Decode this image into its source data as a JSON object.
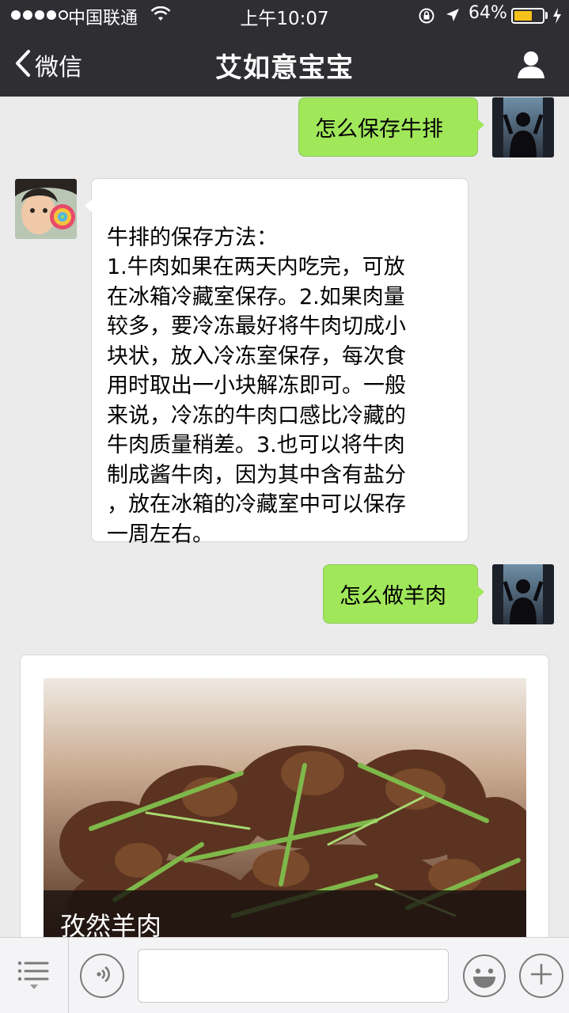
{
  "status_bar": {
    "carrier": "中国联通",
    "time": "上午10:07",
    "battery_percent": "64%",
    "battery_level": 0.64,
    "battery_color": "#f5c21b",
    "signal_bars_filled": 4,
    "signal_bars_total": 5
  },
  "nav": {
    "back_label": "微信",
    "title": "艾如意宝宝",
    "back_icon": "chevron-left-icon",
    "profile_icon": "person-icon"
  },
  "messages": [
    {
      "direction": "outgoing",
      "text": "怎么保存牛排",
      "avatar": "user-avatar"
    },
    {
      "direction": "incoming",
      "text": "牛排的保存方法：\n1.牛肉如果在两天内吃完，可放\n在冰箱冷藏室保存。2.如果肉量\n较多，要冷冻最好将牛肉切成小\n块状，放入冷冻室保存，每次食\n用时取出一小块解冻即可。一般\n来说，冷冻的牛肉口感比冷藏的\n牛肉质量稍差。3.也可以将牛肉\n制成酱牛肉，因为其中含有盐分\n，放在冰箱的冷藏室中可以保存\n一周左右。",
      "avatar": "bot-avatar"
    },
    {
      "direction": "outgoing",
      "text": "怎么做羊肉",
      "avatar": "user-avatar"
    },
    {
      "direction": "incoming",
      "type": "card",
      "caption": "孜然羊肉",
      "image": "cumin-lamb-photo"
    }
  ],
  "colors": {
    "header_bg": "#2f2e33",
    "chat_bg": "#ebebeb",
    "outgoing_bubble": "#a0e75a",
    "incoming_bubble": "#ffffff"
  },
  "input_bar": {
    "value": "",
    "placeholder": "",
    "icons": [
      "menu-list-icon",
      "voice-icon",
      "emoji-icon",
      "plus-icon"
    ]
  }
}
